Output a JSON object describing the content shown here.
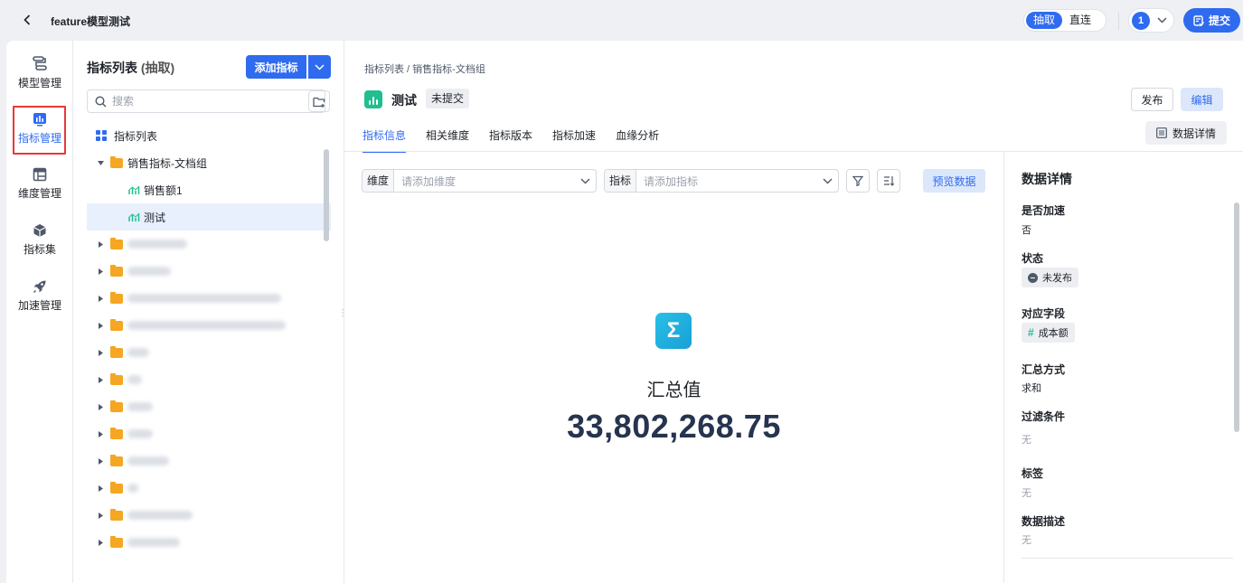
{
  "app": {
    "title": "feature模型测试"
  },
  "header": {
    "mode_options": [
      "抽取",
      "直连"
    ],
    "active_mode": "抽取",
    "version": "1",
    "submit_label": "提交"
  },
  "rail": {
    "items": [
      {
        "label": "模型管理",
        "icon": "model-flow-icon"
      },
      {
        "label": "指标管理",
        "icon": "metric-chart-icon",
        "active": true
      },
      {
        "label": "维度管理",
        "icon": "dimension-table-icon"
      },
      {
        "label": "指标集",
        "icon": "cube-icon"
      },
      {
        "label": "加速管理",
        "icon": "rocket-icon"
      }
    ]
  },
  "tree": {
    "title": "指标列表",
    "title_suffix": "(抽取)",
    "add_label": "添加指标",
    "search_placeholder": "搜索",
    "root_label": "指标列表",
    "group_label": "销售指标-文档组",
    "children": [
      "销售额1",
      "测试"
    ],
    "selected": "测试"
  },
  "center": {
    "breadcrumb": "指标列表 / 销售指标-文档组",
    "metric_name": "测试",
    "status": "未提交",
    "publish_label": "发布",
    "edit_label": "编辑",
    "tabs": [
      "指标信息",
      "相关维度",
      "指标版本",
      "指标加速",
      "血缘分析"
    ],
    "active_tab": "指标信息",
    "detail_button": "数据详情",
    "dimension_filter": {
      "label": "维度",
      "placeholder": "请添加维度"
    },
    "metric_filter": {
      "label": "指标",
      "placeholder": "请添加指标"
    },
    "preview_label": "预览数据",
    "summary_label": "汇总值",
    "summary_value": "33,802,268.75"
  },
  "details": {
    "title": "数据详情",
    "accelerate_label": "是否加速",
    "accelerate_value": "否",
    "status_label": "状态",
    "status_value": "未发布",
    "field_label": "对应字段",
    "field_value": "成本额",
    "agg_label": "汇总方式",
    "agg_value": "求和",
    "filter_label": "过滤条件",
    "filter_value": "无",
    "tag_label": "标签",
    "tag_value": "无",
    "desc_label": "数据描述",
    "desc_value": "无"
  },
  "colors": {
    "accent": "#2f6bef",
    "metric_green": "#1fbf8f",
    "highlight_red": "#e53935"
  }
}
